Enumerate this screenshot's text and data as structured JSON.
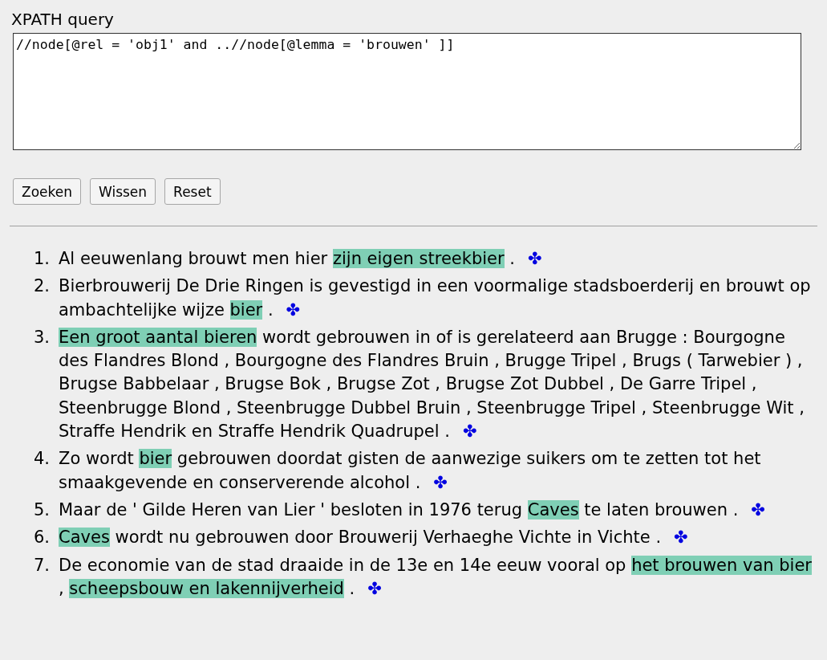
{
  "query": {
    "label": "XPATH query",
    "value": "//node[@rel = 'obj1' and ..//node[@lemma = 'brouwen' ]]"
  },
  "buttons": [
    "Zoeken",
    "Wissen",
    "Reset"
  ],
  "results": [
    {
      "number": "1.",
      "marker": "✤",
      "segments": [
        {
          "text": "Al eeuwenlang brouwt men hier ",
          "highlighted": false
        },
        {
          "text": "zijn eigen streekbier",
          "highlighted": true
        },
        {
          "text": " .",
          "highlighted": false
        }
      ]
    },
    {
      "number": "2.",
      "marker": "✤",
      "segments": [
        {
          "text": "Bierbrouwerij De Drie Ringen is gevestigd in een voormalige stadsboerderij en brouwt op ambachtelijke wijze ",
          "highlighted": false
        },
        {
          "text": "bier",
          "highlighted": true
        },
        {
          "text": " .",
          "highlighted": false
        }
      ]
    },
    {
      "number": "3.",
      "marker": "✤",
      "segments": [
        {
          "text": "Een groot aantal bieren",
          "highlighted": true
        },
        {
          "text": " wordt gebrouwen in of is gerelateerd aan Brugge : Bourgogne des Flandres Blond , Bourgogne des Flandres Bruin , Brugge Tripel , Brugs ( Tarwebier ) , Brugse Babbelaar , Brugse Bok , Brugse Zot , Brugse Zot Dubbel , De Garre Tripel , Steenbrugge Blond , Steenbrugge Dubbel Bruin , Steenbrugge Tripel , Steenbrugge Wit , Straffe Hendrik en Straffe Hendrik Quadrupel .",
          "highlighted": false
        }
      ]
    },
    {
      "number": "4.",
      "marker": "✤",
      "segments": [
        {
          "text": "Zo wordt ",
          "highlighted": false
        },
        {
          "text": "bier",
          "highlighted": true
        },
        {
          "text": " gebrouwen doordat gisten de aanwezige suikers om te zetten tot het smaakgevende en conserverende alcohol .",
          "highlighted": false
        }
      ]
    },
    {
      "number": "5.",
      "marker": "✤",
      "segments": [
        {
          "text": "Maar de ' Gilde Heren van Lier ' besloten in 1976 terug ",
          "highlighted": false
        },
        {
          "text": "Caves",
          "highlighted": true
        },
        {
          "text": " te laten brouwen .",
          "highlighted": false
        }
      ]
    },
    {
      "number": "6.",
      "marker": "✤",
      "segments": [
        {
          "text": "Caves",
          "highlighted": true
        },
        {
          "text": " wordt nu gebrouwen door Brouwerij Verhaeghe Vichte in Vichte .",
          "highlighted": false
        }
      ]
    },
    {
      "number": "7.",
      "marker": "✤",
      "segments": [
        {
          "text": "De economie van de stad draaide in de 13e en 14e eeuw vooral op ",
          "highlighted": false
        },
        {
          "text": "het brouwen van bier",
          "highlighted": true
        },
        {
          "text": " , ",
          "highlighted": false
        },
        {
          "text": "scheepsbouw en lakennijverheid",
          "highlighted": true
        },
        {
          "text": " .",
          "highlighted": false
        }
      ]
    }
  ]
}
